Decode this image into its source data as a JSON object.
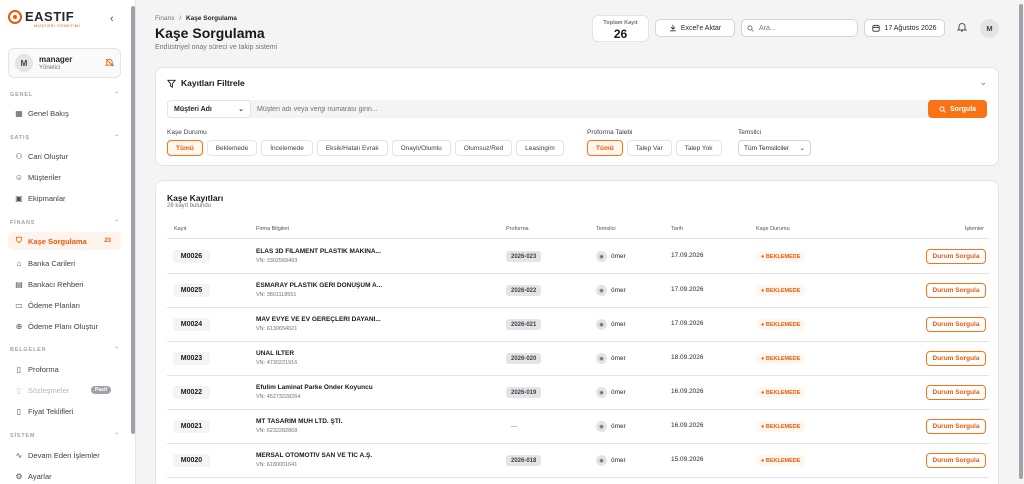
{
  "brand": {
    "name": "EASTIF",
    "tagline": "MÜŞTERİ YÖNETİMİ"
  },
  "user": {
    "name": "manager",
    "role": "Yönetici",
    "initial": "M"
  },
  "sidebar": {
    "sections": [
      {
        "title": "GENEL",
        "items": [
          {
            "label": "Genel Bakış",
            "icon": "grid-icon"
          }
        ]
      },
      {
        "title": "SATIŞ",
        "items": [
          {
            "label": "Cari Oluştur",
            "icon": "user-plus-icon"
          },
          {
            "label": "Müşteriler",
            "icon": "users-icon"
          },
          {
            "label": "Ekipmanlar",
            "icon": "briefcase-icon"
          }
        ]
      },
      {
        "title": "FİNANS",
        "items": [
          {
            "label": "Kaşe Sorgulama",
            "icon": "shield-icon",
            "badge": "23",
            "active": true
          },
          {
            "label": "Banka Carileri",
            "icon": "bank-icon"
          },
          {
            "label": "Bankacı Rehberi",
            "icon": "book-icon"
          },
          {
            "label": "Ödeme Planları",
            "icon": "calendar-icon"
          },
          {
            "label": "Ödeme Planı Oluştur",
            "icon": "plus-circle-icon"
          }
        ]
      },
      {
        "title": "BELGELER",
        "items": [
          {
            "label": "Proforma",
            "icon": "file-icon"
          },
          {
            "label": "Sözleşmeler",
            "icon": "document-icon",
            "tag": "Pasif",
            "disabled": true
          },
          {
            "label": "Fiyat Teklifleri",
            "icon": "file-text-icon"
          }
        ]
      },
      {
        "title": "SİSTEM",
        "items": [
          {
            "label": "Devam Eden İşlemler",
            "icon": "activity-icon"
          },
          {
            "label": "Ayarlar",
            "icon": "gear-icon"
          }
        ]
      }
    ]
  },
  "header": {
    "breadcrumb_parent": "Finans",
    "breadcrumb_sep": "/",
    "breadcrumb_current": "Kaşe Sorgulama",
    "title": "Kaşe Sorgulama",
    "subtitle": "Endüstriyel onay süreci ve takip sistemi",
    "total_label": "Toplam Kayıt",
    "total_value": "26",
    "excel_label": "Excel'e Aktar",
    "search_placeholder": "Ara...",
    "date": "17 Ağustos 2026"
  },
  "filter": {
    "title": "Kayıtları Filtrele",
    "field_select": "Müşteri Adı",
    "search_placeholder": "Müşteri adı veya vergi numarası girin...",
    "query_button": "Sorgula",
    "kase_label": "Kaşe Durumu",
    "kase_options": [
      "Tümü",
      "Beklemede",
      "İncelemede",
      "Eksik/Hatalı Evrak",
      "Onaylı/Olumlu",
      "Olumsuz/Red",
      "Leasingim"
    ],
    "proforma_label": "Proforma Talebi",
    "proforma_options": [
      "Tümü",
      "Talep Var",
      "Talep Yok"
    ],
    "rep_label": "Temsilci",
    "rep_value": "Tüm Temsilciler"
  },
  "records": {
    "title": "Kaşe Kayıtları",
    "subtitle": "26 kayıt bulundu",
    "columns": [
      "Kayıt",
      "Firma Bilgileri",
      "Proforma",
      "Temsilci",
      "Tarih",
      "Kaşe Durumu",
      "İşlemler"
    ],
    "action_label": "Durum Sorgula",
    "rows": [
      {
        "id": "M0026",
        "firm": "ELAS 3D FİLAMENT PLASTİK MAKİNA...",
        "vn": "VN: 3302569493",
        "proforma": "2026-023",
        "rep": "ömer",
        "date": "17.09.2026",
        "status": "● BEKLEMEDE"
      },
      {
        "id": "M0025",
        "firm": "ESMARAY PLASTİK GERİ DÖNÜŞÜM A...",
        "vn": "VN: 3801118551",
        "proforma": "2026-022",
        "rep": "ömer",
        "date": "17.09.2026",
        "status": "● BEKLEMEDE"
      },
      {
        "id": "M0024",
        "firm": "MAV EVYE VE EV GEREÇLERİ DAYANI...",
        "vn": "VN: 6130654021",
        "proforma": "2026-021",
        "rep": "ömer",
        "date": "17.09.2026",
        "status": "● BEKLEMEDE"
      },
      {
        "id": "M0023",
        "firm": "ÜNAL İLTER",
        "vn": "VN: 4730221916",
        "proforma": "2026-020",
        "rep": "ömer",
        "date": "18.09.2026",
        "status": "● BEKLEMEDE"
      },
      {
        "id": "M0022",
        "firm": "Efulim Laminat Parke Önder Koyuncu",
        "vn": "VN: 45273228264",
        "proforma": "2026-019",
        "rep": "ömer",
        "date": "16.09.2026",
        "status": "● BEKLEMEDE"
      },
      {
        "id": "M0021",
        "firm": "MT TASARIM MÜH LTD. ŞTİ.",
        "vn": "VN: 6232282868",
        "proforma": "—",
        "rep": "ömer",
        "date": "16.09.2026",
        "status": "● BEKLEMEDE"
      },
      {
        "id": "M0020",
        "firm": "MERSAL OTOMOTİV SAN VE TİC A.Ş.",
        "vn": "VN: 6180001641",
        "proforma": "2026-018",
        "rep": "ömer",
        "date": "15.09.2026",
        "status": "● BEKLEMEDE"
      }
    ]
  },
  "colors": {
    "accent": "#f97316",
    "accent_dark": "#ea580c",
    "accent_bg": "#fff7ed"
  }
}
